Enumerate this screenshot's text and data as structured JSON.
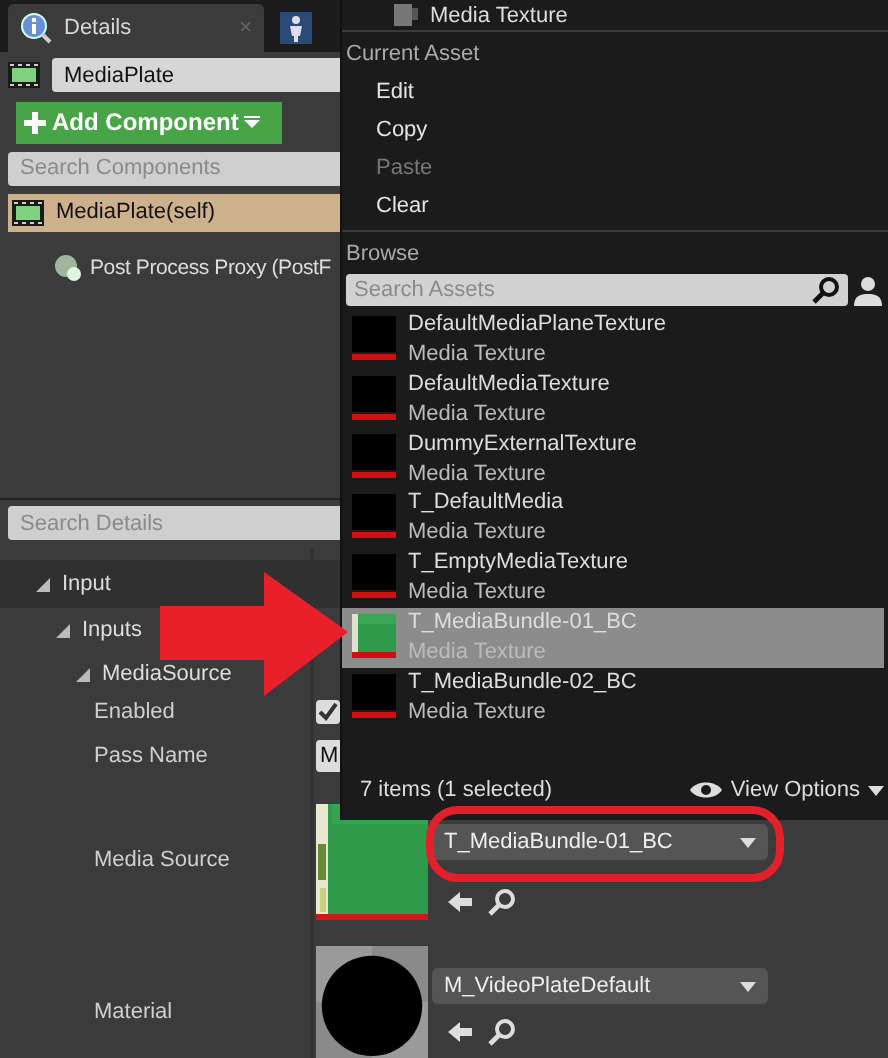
{
  "details_tab": {
    "title": "Details",
    "close": "×"
  },
  "actor_name": {
    "value": "MediaPlate"
  },
  "add_component": {
    "label": "Add Component"
  },
  "component_search": {
    "placeholder": "Search Components"
  },
  "components": [
    {
      "label": "MediaPlate(self)",
      "selected": true,
      "children": [
        {
          "label": "Post Process Proxy (PostF",
          "selected": false
        }
      ]
    }
  ],
  "details_search": {
    "placeholder": "Search Details"
  },
  "categories": [
    {
      "label": "Input",
      "expanded": true,
      "children": [
        {
          "label": "Inputs",
          "expanded": true,
          "children": [
            {
              "label": "MediaSource",
              "expanded": true
            }
          ]
        }
      ]
    }
  ],
  "properties": [
    {
      "name": "Enabled",
      "kind": "checkbox",
      "checked": true
    },
    {
      "name": "Pass Name",
      "kind": "text",
      "value": "M"
    },
    {
      "name": "Media Source",
      "kind": "texture",
      "value": "T_MediaBundle-01_BC"
    },
    {
      "name": "Material",
      "kind": "material",
      "value": "M_VideoPlateDefault"
    }
  ],
  "asset_menu": {
    "header_item": "Media Texture",
    "sections": [
      {
        "title": "Current Asset",
        "items": [
          {
            "label": "Edit",
            "disabled": false
          },
          {
            "label": "Copy",
            "disabled": false
          },
          {
            "label": "Paste",
            "disabled": true
          },
          {
            "label": "Clear",
            "disabled": false
          }
        ]
      }
    ],
    "browse": {
      "title": "Browse",
      "placeholder": "Search Assets",
      "assets": [
        {
          "name": "DefaultMediaPlaneTexture",
          "type": "Media Texture",
          "selected": false,
          "kind": "blank"
        },
        {
          "name": "DefaultMediaTexture",
          "type": "Media Texture",
          "selected": false,
          "kind": "blank"
        },
        {
          "name": "DummyExternalTexture",
          "type": "Media Texture",
          "selected": false,
          "kind": "blank"
        },
        {
          "name": "T_DefaultMedia",
          "type": "Media Texture",
          "selected": false,
          "kind": "blank"
        },
        {
          "name": "T_EmptyMediaTexture",
          "type": "Media Texture",
          "selected": false,
          "kind": "blank"
        },
        {
          "name": "T_MediaBundle-01_BC",
          "type": "Media Texture",
          "selected": true,
          "kind": "picture"
        },
        {
          "name": "T_MediaBundle-02_BC",
          "type": "Media Texture",
          "selected": false,
          "kind": "blank"
        }
      ],
      "status": "7 items (1 selected)",
      "view_options": "View Options"
    }
  }
}
